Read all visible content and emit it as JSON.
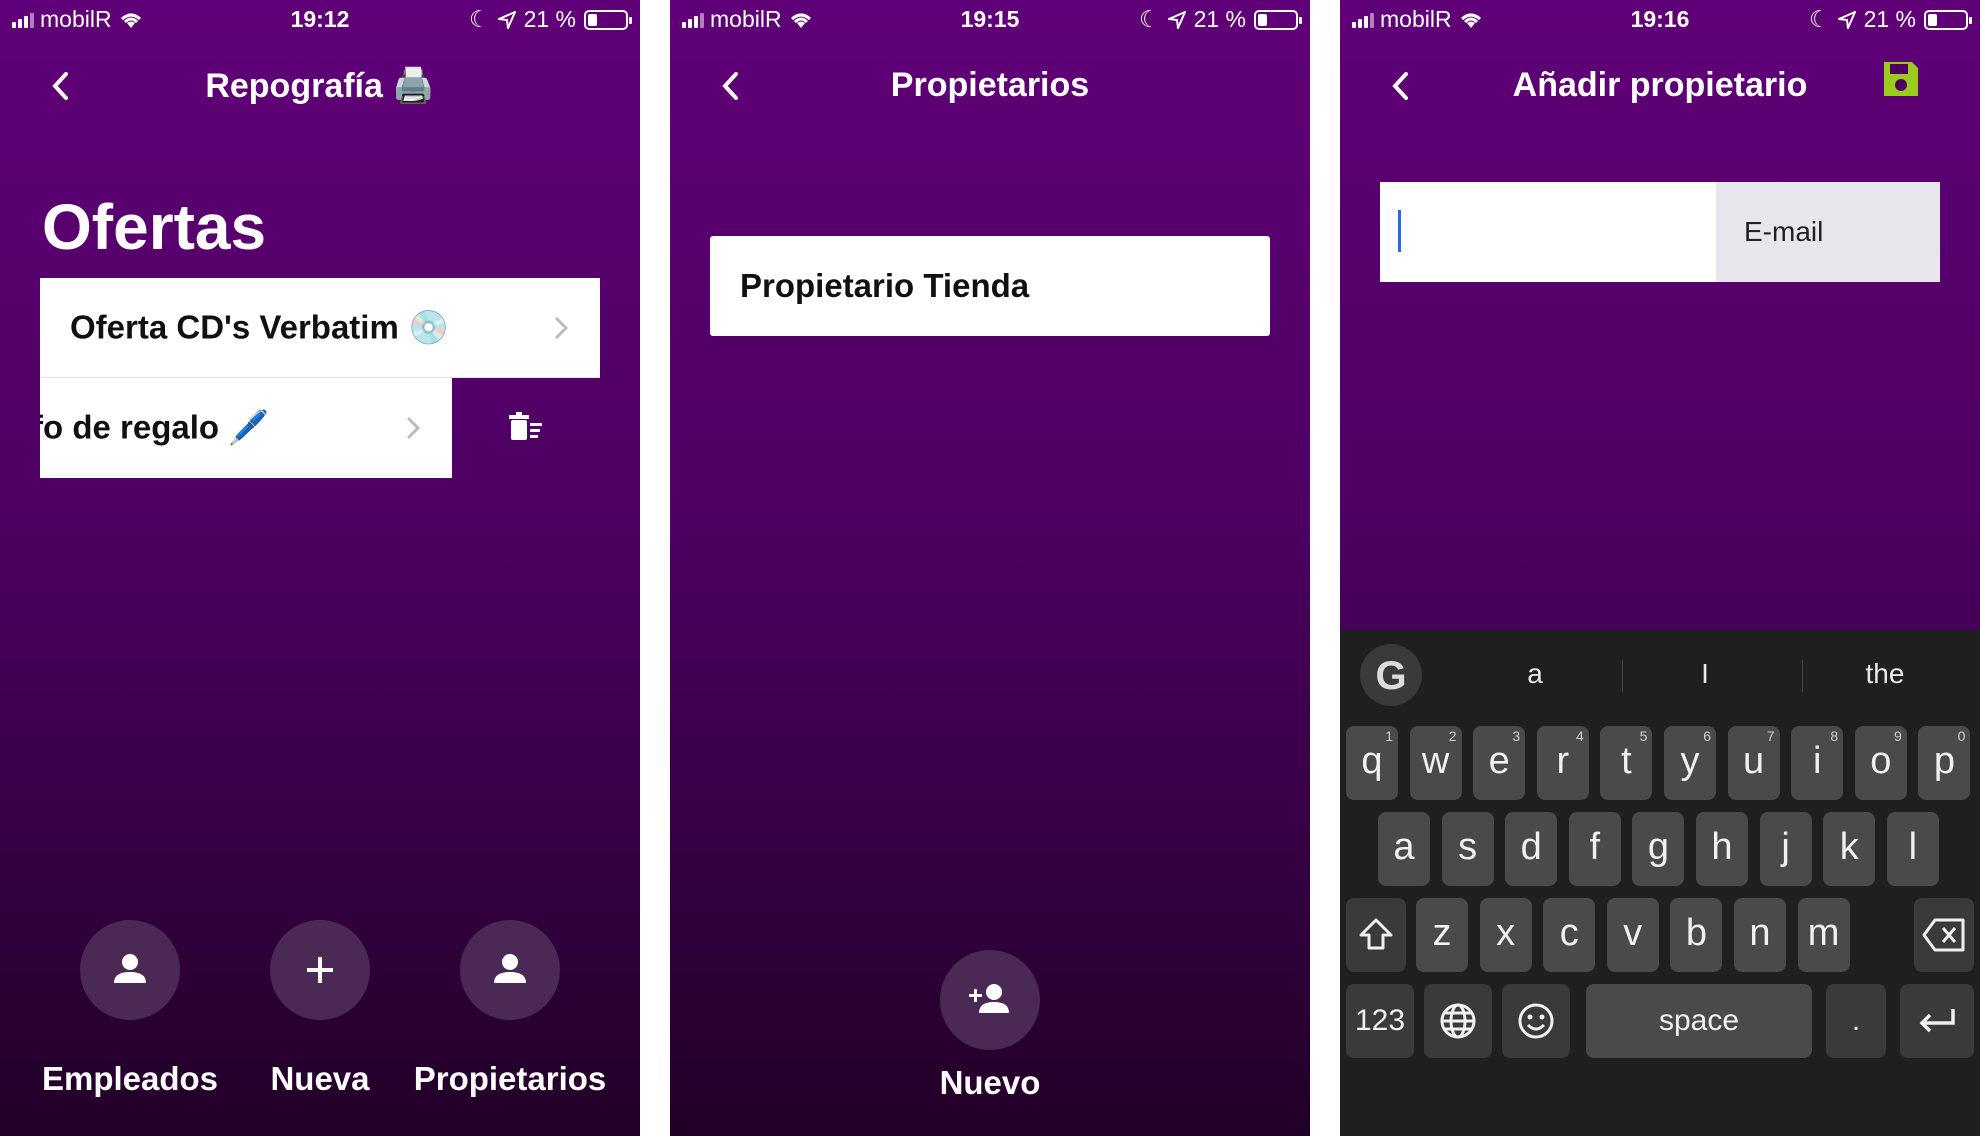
{
  "status_bars": [
    {
      "carrier": "mobilR",
      "time": "19:12",
      "battery": "21 %"
    },
    {
      "carrier": "mobilR",
      "time": "19:15",
      "battery": "21 %"
    },
    {
      "carrier": "mobilR",
      "time": "19:16",
      "battery": "21 %"
    }
  ],
  "screen1": {
    "nav_title": "Repografía 🖨️",
    "section_title": "Ofertas",
    "offers": [
      {
        "label": "Oferta CD's Verbatim 💿"
      },
      {
        "label": "fo de regalo 🖊️"
      }
    ],
    "actions": [
      {
        "label": "Empleados",
        "icon": "person-icon"
      },
      {
        "label": "Nueva",
        "icon": "plus-icon"
      },
      {
        "label": "Propietarios",
        "icon": "person-icon"
      }
    ]
  },
  "screen2": {
    "nav_title": "Propietarios",
    "owners": [
      {
        "label": "Propietario Tienda"
      }
    ],
    "fab": {
      "label": "Nuevo",
      "icon": "add-person-icon"
    }
  },
  "screen3": {
    "nav_title": "Añadir propietario",
    "email_tag": "E-mail",
    "email_value": "",
    "keyboard": {
      "suggestions": [
        "a",
        "I",
        "the"
      ],
      "google_label": "G",
      "row1": [
        {
          "k": "q",
          "n": "1"
        },
        {
          "k": "w",
          "n": "2"
        },
        {
          "k": "e",
          "n": "3"
        },
        {
          "k": "r",
          "n": "4"
        },
        {
          "k": "t",
          "n": "5"
        },
        {
          "k": "y",
          "n": "6"
        },
        {
          "k": "u",
          "n": "7"
        },
        {
          "k": "i",
          "n": "8"
        },
        {
          "k": "o",
          "n": "9"
        },
        {
          "k": "p",
          "n": "0"
        }
      ],
      "row2": [
        "a",
        "s",
        "d",
        "f",
        "g",
        "h",
        "j",
        "k",
        "l"
      ],
      "row3": [
        "z",
        "x",
        "c",
        "v",
        "b",
        "n",
        "m"
      ],
      "numbers_label": "123",
      "space_label": "space",
      "period_label": "."
    }
  },
  "colors": {
    "accent_save": "#9ccc1b",
    "caret": "#2a6ae0"
  }
}
